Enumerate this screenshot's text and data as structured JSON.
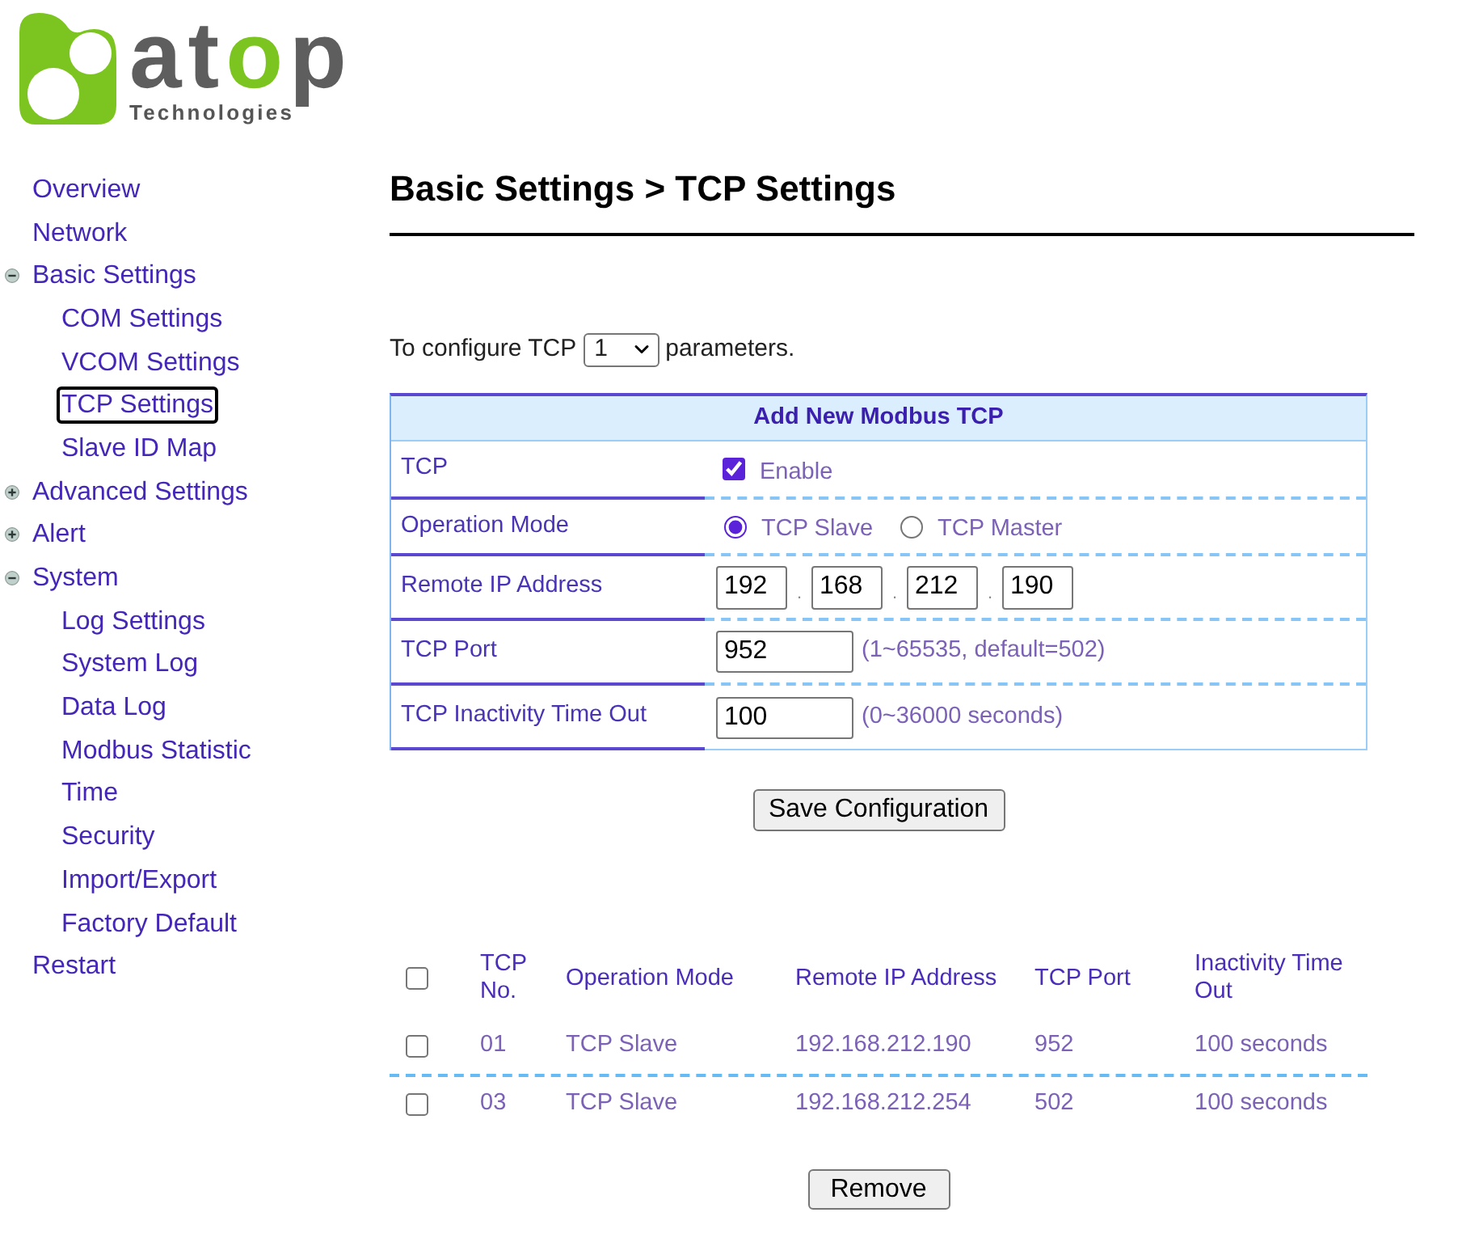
{
  "logo": {
    "wordmark": [
      {
        "text": "at",
        "accent": false
      },
      {
        "text": "o",
        "accent": true
      },
      {
        "text": "p",
        "accent": false
      }
    ],
    "tagline": "Technologies"
  },
  "sidebar": {
    "items": [
      {
        "kind": "page",
        "label": "Overview",
        "selected": false
      },
      {
        "kind": "page",
        "label": "Network",
        "selected": false
      },
      {
        "kind": "group",
        "label": "Basic Settings",
        "selected": false,
        "expanded": true,
        "children": [
          {
            "label": "COM Settings",
            "selected": false
          },
          {
            "label": "VCOM Settings",
            "selected": false
          },
          {
            "label": "TCP Settings",
            "selected": true
          },
          {
            "label": "Slave ID Map",
            "selected": false
          }
        ]
      },
      {
        "kind": "group",
        "label": "Advanced Settings",
        "selected": false,
        "expanded": false
      },
      {
        "kind": "group",
        "label": "Alert",
        "selected": false,
        "expanded": false
      },
      {
        "kind": "group",
        "label": "System",
        "selected": false,
        "expanded": true,
        "children": [
          {
            "label": "Log Settings",
            "selected": false
          },
          {
            "label": "System Log",
            "selected": false
          },
          {
            "label": "Data Log",
            "selected": false
          },
          {
            "label": "Modbus Statistic",
            "selected": false
          },
          {
            "label": "Time",
            "selected": false
          },
          {
            "label": "Security",
            "selected": false
          },
          {
            "label": "Import/Export",
            "selected": false
          },
          {
            "label": "Factory Default",
            "selected": false
          }
        ]
      },
      {
        "kind": "page",
        "label": "Restart",
        "selected": false
      }
    ]
  },
  "page": {
    "title": "Basic Settings > TCP Settings"
  },
  "selector": {
    "prefix": "To configure TCP",
    "value": "1",
    "suffix": "parameters."
  },
  "form": {
    "title": "Add New Modbus TCP",
    "rows": [
      {
        "kind": "checkbox",
        "label": "TCP",
        "checked": true,
        "option": "Enable"
      },
      {
        "kind": "radio",
        "label": "Operation Mode",
        "options": [
          {
            "label": "TCP Slave",
            "selected": true
          },
          {
            "label": "TCP Master",
            "selected": false
          }
        ]
      },
      {
        "kind": "ip",
        "label": "Remote IP Address",
        "octets": [
          "192",
          "168",
          "212",
          "190"
        ],
        "separators": [
          ".",
          ".",
          "."
        ]
      },
      {
        "kind": "number",
        "label": "TCP Port",
        "value": "952",
        "hint": "(1~65535, default=502)"
      },
      {
        "kind": "number",
        "label": "TCP Inactivity Time Out",
        "value": "100",
        "hint": "(0~36000 seconds)"
      }
    ]
  },
  "save_button": "Save Configuration",
  "list": {
    "header_checked": false,
    "columns": [
      "TCP No.",
      "Operation Mode",
      "Remote IP Address",
      "TCP Port",
      "Inactivity Time Out"
    ],
    "rows": [
      {
        "checked": false,
        "cells": [
          "01",
          "TCP Slave",
          "192.168.212.190",
          "952",
          "100 seconds"
        ]
      },
      {
        "checked": false,
        "cells": [
          "03",
          "TCP Slave",
          "192.168.212.254",
          "502",
          "100 seconds"
        ]
      }
    ]
  },
  "remove_button": "Remove"
}
